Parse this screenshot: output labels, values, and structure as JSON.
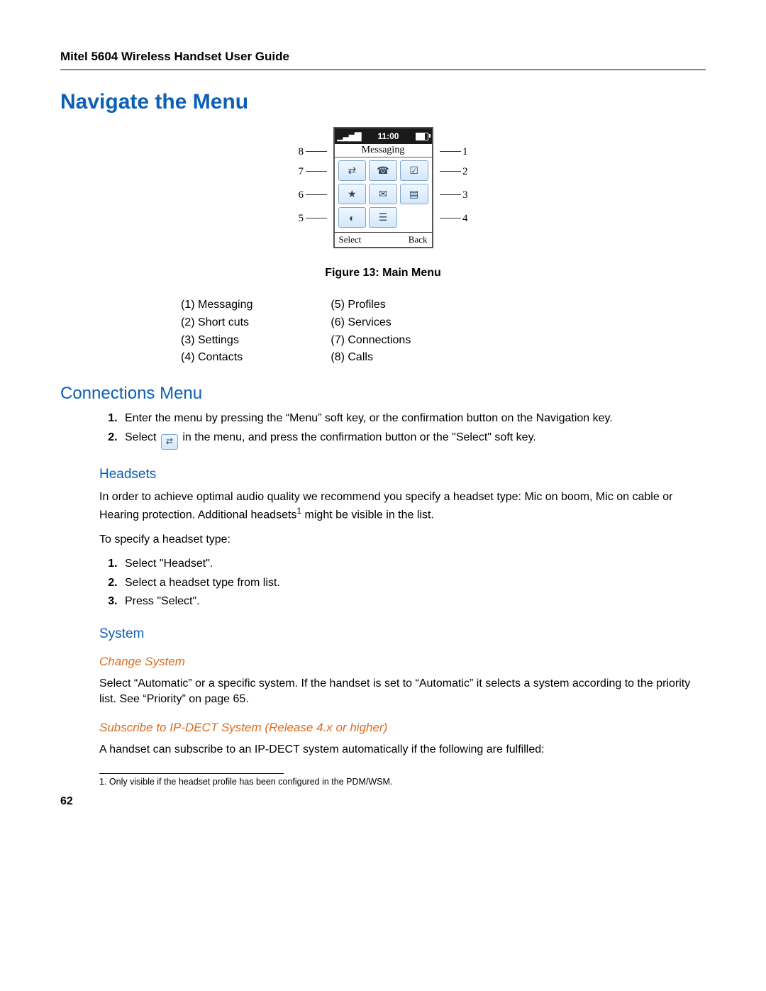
{
  "header": {
    "title": "Mitel 5604 Wireless Handset User Guide"
  },
  "h1": "Navigate the Menu",
  "figure": {
    "status_time": "11:00",
    "title": "Messaging",
    "soft_left": "Select",
    "soft_right": "Back",
    "callouts": {
      "c1": "1",
      "c2": "2",
      "c3": "3",
      "c4": "4",
      "c5": "5",
      "c6": "6",
      "c7": "7",
      "c8": "8"
    },
    "caption": "Figure 13: Main Menu"
  },
  "legend": {
    "left": [
      "(1) Messaging",
      "(2) Short cuts",
      "(3) Settings",
      "(4) Contacts"
    ],
    "right": [
      "(5) Profiles",
      "(6) Services",
      "(7) Connections",
      "(8) Calls"
    ]
  },
  "connections": {
    "h2": "Connections Menu",
    "steps": [
      "Enter the menu by pressing the “Menu” soft key, or the confirmation button on the Navigation key.",
      [
        "Select ",
        " in the menu, and press the confirmation button or the \"Select\" soft key."
      ]
    ]
  },
  "headsets": {
    "h3": "Headsets",
    "para1_a": "In order to achieve optimal audio quality we recommend you specify a headset type: Mic on boom, Mic on cable or Hearing protection. Additional headsets",
    "para1_b": " might be visible in the list.",
    "para2": "To specify a headset type:",
    "steps": [
      "Select \"Headset\".",
      "Select a headset type from list.",
      "Press \"Select\"."
    ]
  },
  "system": {
    "h3": "System",
    "change_h4": "Change System",
    "change_p": "Select “Automatic” or a specific system. If the handset is set to “Automatic” it selects a system according to the priority list. See “Priority” on page 65.",
    "sub_h4": "Subscribe to IP-DECT System (Release 4.x or higher)",
    "sub_p": "A handset can subscribe to an IP-DECT system automatically if the following are fulfilled:"
  },
  "footnote": "1. Only visible if the headset profile has been configured in the PDM/WSM.",
  "page_number": "62"
}
